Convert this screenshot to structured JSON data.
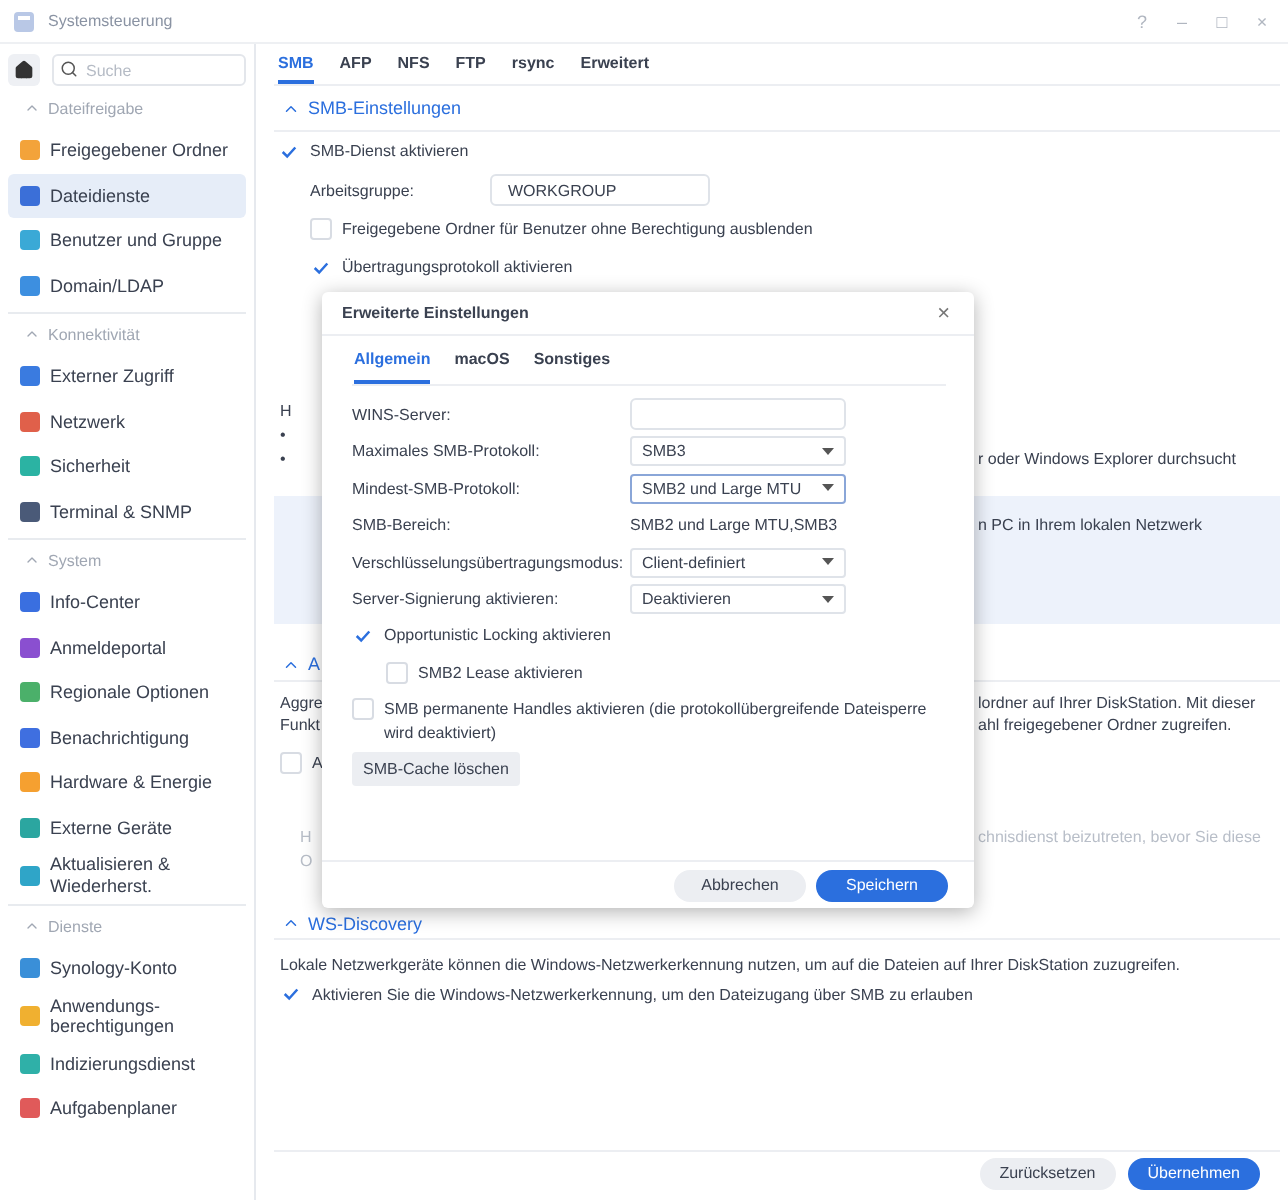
{
  "window": {
    "title": "Systemsteuerung",
    "controls": [
      "?",
      "–",
      "□",
      "×"
    ]
  },
  "sidebar": {
    "search": {
      "placeholder": "Suche"
    },
    "groups": [
      {
        "title": "Dateifreigabe",
        "items": [
          {
            "label": "Freigegebener Ordner",
            "color": "#f3a33a",
            "selected": false
          },
          {
            "label": "Dateidienste",
            "color": "#3b6fd8",
            "selected": true
          },
          {
            "label": "Benutzer und Gruppe",
            "color": "#3aa9d6",
            "selected": false
          },
          {
            "label": "Domain/LDAP",
            "color": "#3d8fe0",
            "selected": false
          }
        ]
      },
      {
        "title": "Konnektivität",
        "items": [
          {
            "label": "Externer Zugriff",
            "color": "#3a7be0",
            "selected": false
          },
          {
            "label": "Netzwerk",
            "color": "#e0604a",
            "selected": false
          },
          {
            "label": "Sicherheit",
            "color": "#2bb3a3",
            "selected": false
          },
          {
            "label": "Terminal & SNMP",
            "color": "#4a5a78",
            "selected": false
          }
        ]
      },
      {
        "title": "System",
        "items": [
          {
            "label": "Info-Center",
            "color": "#3a6fe0",
            "selected": false
          },
          {
            "label": "Anmeldeportal",
            "color": "#8a4fd0",
            "selected": false
          },
          {
            "label": "Regionale Optionen",
            "color": "#4bb06a",
            "selected": false
          },
          {
            "label": "Benachrichtigung",
            "color": "#3f6fe0",
            "selected": false
          },
          {
            "label": "Hardware & Energie",
            "color": "#f5a030",
            "selected": false
          },
          {
            "label": "Externe Geräte",
            "color": "#2ba6a0",
            "selected": false
          },
          {
            "label": "Aktualisieren & Wiederherst.",
            "color": "#2fa5c8",
            "selected": false
          }
        ]
      },
      {
        "title": "Dienste",
        "items": [
          {
            "label": "Synology-Konto",
            "color": "#3a8fd8",
            "selected": false
          },
          {
            "label": "Anwendungs-berechtigungen",
            "color": "#f0b030",
            "selected": false
          },
          {
            "label": "Indizierungsdienst",
            "color": "#2fb0a8",
            "selected": false
          },
          {
            "label": "Aufgabenplaner",
            "color": "#e05a5a",
            "selected": false
          }
        ]
      }
    ]
  },
  "tabs": [
    {
      "label": "SMB",
      "selected": true
    },
    {
      "label": "AFP",
      "selected": false
    },
    {
      "label": "NFS",
      "selected": false
    },
    {
      "label": "FTP",
      "selected": false
    },
    {
      "label": "rsync",
      "selected": false
    },
    {
      "label": "Erweitert",
      "selected": false
    }
  ],
  "smb_settings": {
    "title": "SMB-Einstellungen",
    "enable_smb": {
      "label": "SMB-Dienst aktivieren",
      "checked": true
    },
    "workgroup": {
      "label": "Arbeitsgruppe:",
      "value": "WORKGROUP"
    },
    "options": [
      {
        "label": "Freigegebene Ordner für Benutzer ohne Berechtigung ausblenden",
        "checked": false
      },
      {
        "label": "Übertragungsprotokoll aktivieren",
        "checked": true
      }
    ],
    "fragments": [
      {
        "left": "H"
      },
      {
        "left": "•"
      },
      {
        "left": "•",
        "right": "r oder Windows Explorer durchsucht"
      }
    ],
    "info_box": "n PC in Ihrem lokalen Netzwerk"
  },
  "section_2": {
    "title": "A",
    "lines": [
      {
        "left": "Aggre",
        "right": "lordner auf Ihrer DiskStation. Mit dieser",
        "disabled": false
      },
      {
        "left": "Funkt",
        "right": "ahl freigegebener Ordner zugreifen.",
        "disabled": false
      }
    ],
    "option": {
      "label": "A",
      "checked": false
    },
    "notes": [
      {
        "left": "H",
        "right": "chnisdienst beizutreten, bevor Sie diese",
        "disabled": true
      },
      {
        "left": "O",
        "disabled": true
      }
    ]
  },
  "ws_discovery": {
    "title": "WS-Discovery",
    "text": "Lokale Netzwerkgeräte können die Windows-Netzwerkerkennung nutzen, um auf die Dateien auf Ihrer DiskStation zuzugreifen.",
    "option": {
      "label": "Aktivieren Sie die Windows-Netzwerkerkennung, um den Dateizugang über SMB zu erlauben",
      "checked": true
    }
  },
  "footer": {
    "buttons": [
      {
        "label": "Zurücksetzen",
        "kind": "secondary"
      },
      {
        "label": "Übernehmen",
        "kind": "primary"
      }
    ]
  },
  "dialog": {
    "title": "Erweiterte Einstellungen",
    "close": "×",
    "tabs": [
      {
        "label": "Allgemein",
        "selected": true
      },
      {
        "label": "macOS",
        "selected": false
      },
      {
        "label": "Sonstiges",
        "selected": false
      }
    ],
    "fields": [
      {
        "kind": "input",
        "label": "WINS-Server:"
      },
      {
        "kind": "select",
        "label": "Maximales SMB-Protokoll:",
        "value": "SMB3",
        "focused": false
      },
      {
        "kind": "select",
        "label": "Mindest-SMB-Protokoll:",
        "value": "SMB2 und Large MTU",
        "focused": true
      },
      {
        "kind": "text",
        "label": "SMB-Bereich:",
        "value": "SMB2 und Large MTU,SMB3"
      },
      {
        "kind": "select",
        "label": "Verschlüsselungsübertragungsmodus:",
        "value": "Client-definiert",
        "focused": false
      },
      {
        "kind": "select",
        "label": "Server-Signierung aktivieren:",
        "value": "Deaktivieren",
        "focused": false
      }
    ],
    "options": [
      {
        "label": "Opportunistic Locking aktivieren",
        "checked": true,
        "children": [
          {
            "label": "SMB2 Lease aktivieren",
            "checked": false
          }
        ]
      },
      {
        "label": "SMB permanente Handles aktivieren (die protokollübergreifende Dateisperre wird deaktiviert)",
        "checked": false
      }
    ],
    "cache_button": "SMB-Cache löschen",
    "buttons": [
      {
        "label": "Abbrechen",
        "kind": "secondary"
      },
      {
        "label": "Speichern",
        "kind": "primary"
      }
    ]
  }
}
